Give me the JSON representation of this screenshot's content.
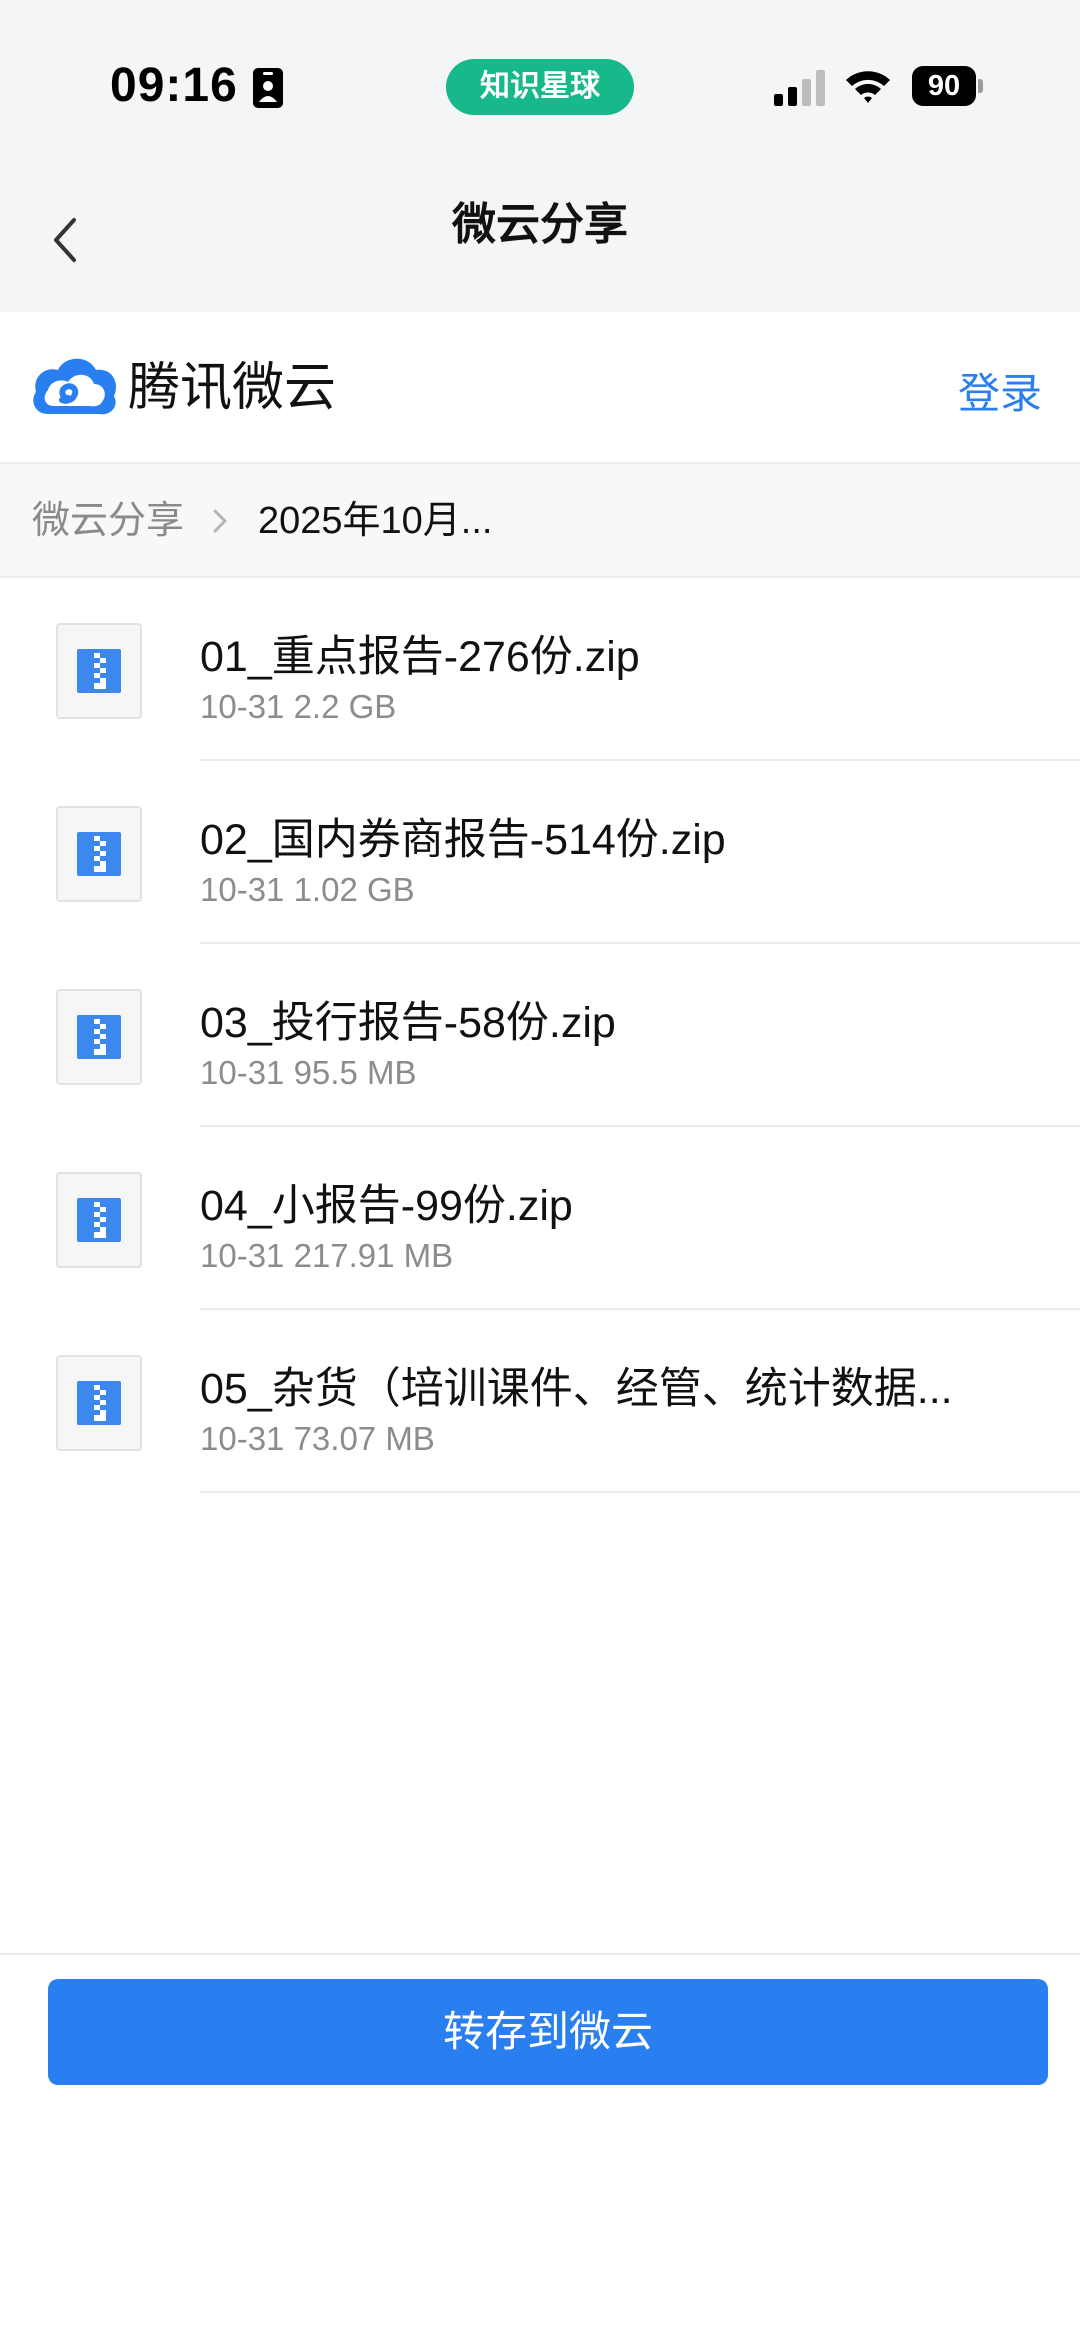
{
  "status_bar": {
    "time": "09:16",
    "center_badge": "知识星球",
    "battery": "90"
  },
  "nav": {
    "title": "微云分享"
  },
  "brand": {
    "name": "腾讯微云",
    "login_label": "登录",
    "accent_color": "#2a7ff0"
  },
  "breadcrumb": {
    "root": "微云分享",
    "current": "2025年10月..."
  },
  "files": [
    {
      "name": "01_重点报告-276份.zip",
      "meta": "10-31 2.2 GB",
      "icon": "zip-file-icon"
    },
    {
      "name": "02_国内券商报告-514份.zip",
      "meta": "10-31 1.02 GB",
      "icon": "zip-file-icon"
    },
    {
      "name": "03_投行报告-58份.zip",
      "meta": "10-31 95.5 MB",
      "icon": "zip-file-icon"
    },
    {
      "name": "04_小报告-99份.zip",
      "meta": "10-31 217.91 MB",
      "icon": "zip-file-icon"
    },
    {
      "name": "05_杂货（培训课件、经管、统计数据...",
      "meta": "10-31 73.07 MB",
      "icon": "zip-file-icon"
    }
  ],
  "actions": {
    "save_label": "转存到微云"
  }
}
